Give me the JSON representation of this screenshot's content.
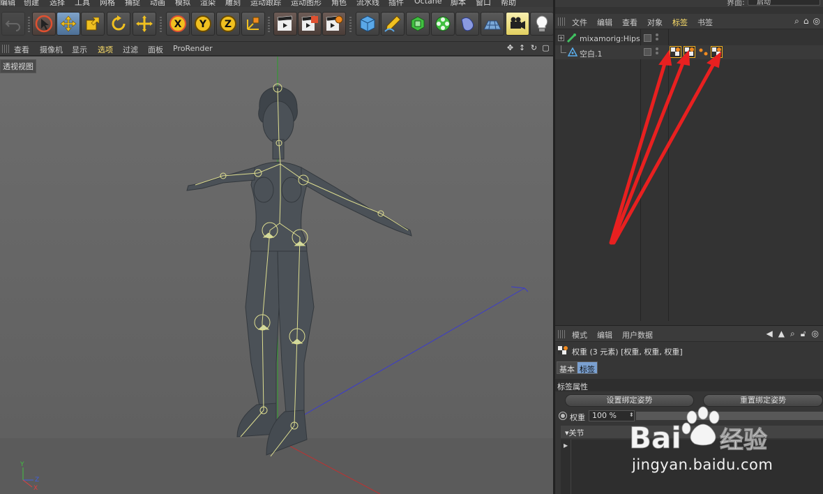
{
  "menubar": {
    "items": [
      "编辑",
      "创建",
      "选择",
      "工具",
      "网格",
      "捕捉",
      "动画",
      "模拟",
      "渲染",
      "雕刻",
      "运动跟踪",
      "运动图形",
      "角色",
      "流水线",
      "插件",
      "Octane",
      "脚本",
      "窗口",
      "帮助"
    ],
    "layout_label": "界面:",
    "layout_value": "启动"
  },
  "toolbar": {
    "buttons": [
      "undo-icon",
      "select-arrow-icon",
      "move-icon",
      "scale-icon",
      "rotate-icon",
      "transform-icon",
      "x-axis-icon",
      "y-axis-icon",
      "z-axis-icon",
      "coordinate-system-icon",
      "render-view-icon",
      "render-picture-icon",
      "render-settings-icon",
      "cube-icon",
      "pen-icon",
      "subdivision-icon",
      "mograph-icon",
      "deformer-icon",
      "floor-icon",
      "camera-icon",
      "light-icon"
    ]
  },
  "viewport": {
    "menu": [
      "查看",
      "摄像机",
      "显示",
      "选项",
      "过滤",
      "面板",
      "ProRender"
    ],
    "active_menu": "选项",
    "label": "透视视图",
    "axis_labels": {
      "y": "Y",
      "z": "Z",
      "x": "X"
    }
  },
  "objects_manager": {
    "menu": [
      "文件",
      "编辑",
      "查看",
      "对象",
      "标签",
      "书签"
    ],
    "active_menu": "标签",
    "objects": [
      {
        "name": "mixamorig:Hips",
        "icon": "joint-icon"
      },
      {
        "name": "空白.1",
        "icon": "null-object-icon",
        "tags": [
          "weight-tag-icon",
          "weight-tag-icon",
          "skin-tag-icon",
          "weight-tag-icon"
        ]
      }
    ]
  },
  "attributes_manager": {
    "menu": [
      "模式",
      "编辑",
      "用户数据"
    ],
    "title": "权重 (3 元素) [权重, 权重, 权重]",
    "tabs": [
      "基本",
      "标签"
    ],
    "active_tab": "标签",
    "section_title": "标签属性",
    "set_bind_pose": "设置绑定姿势",
    "reset_bind_pose": "重置绑定姿势",
    "weight_label": "权重",
    "weight_value": "100 %",
    "joints_label": "▾关节"
  },
  "watermark": {
    "logo_text": "Bai 经验",
    "url": "jingyan.baidu.com"
  },
  "colors": {
    "accent_active": "#ffe06a",
    "arrow_red": "#e82020",
    "tag_border": "#f0b020",
    "tab_active": "#7aa0d0"
  }
}
